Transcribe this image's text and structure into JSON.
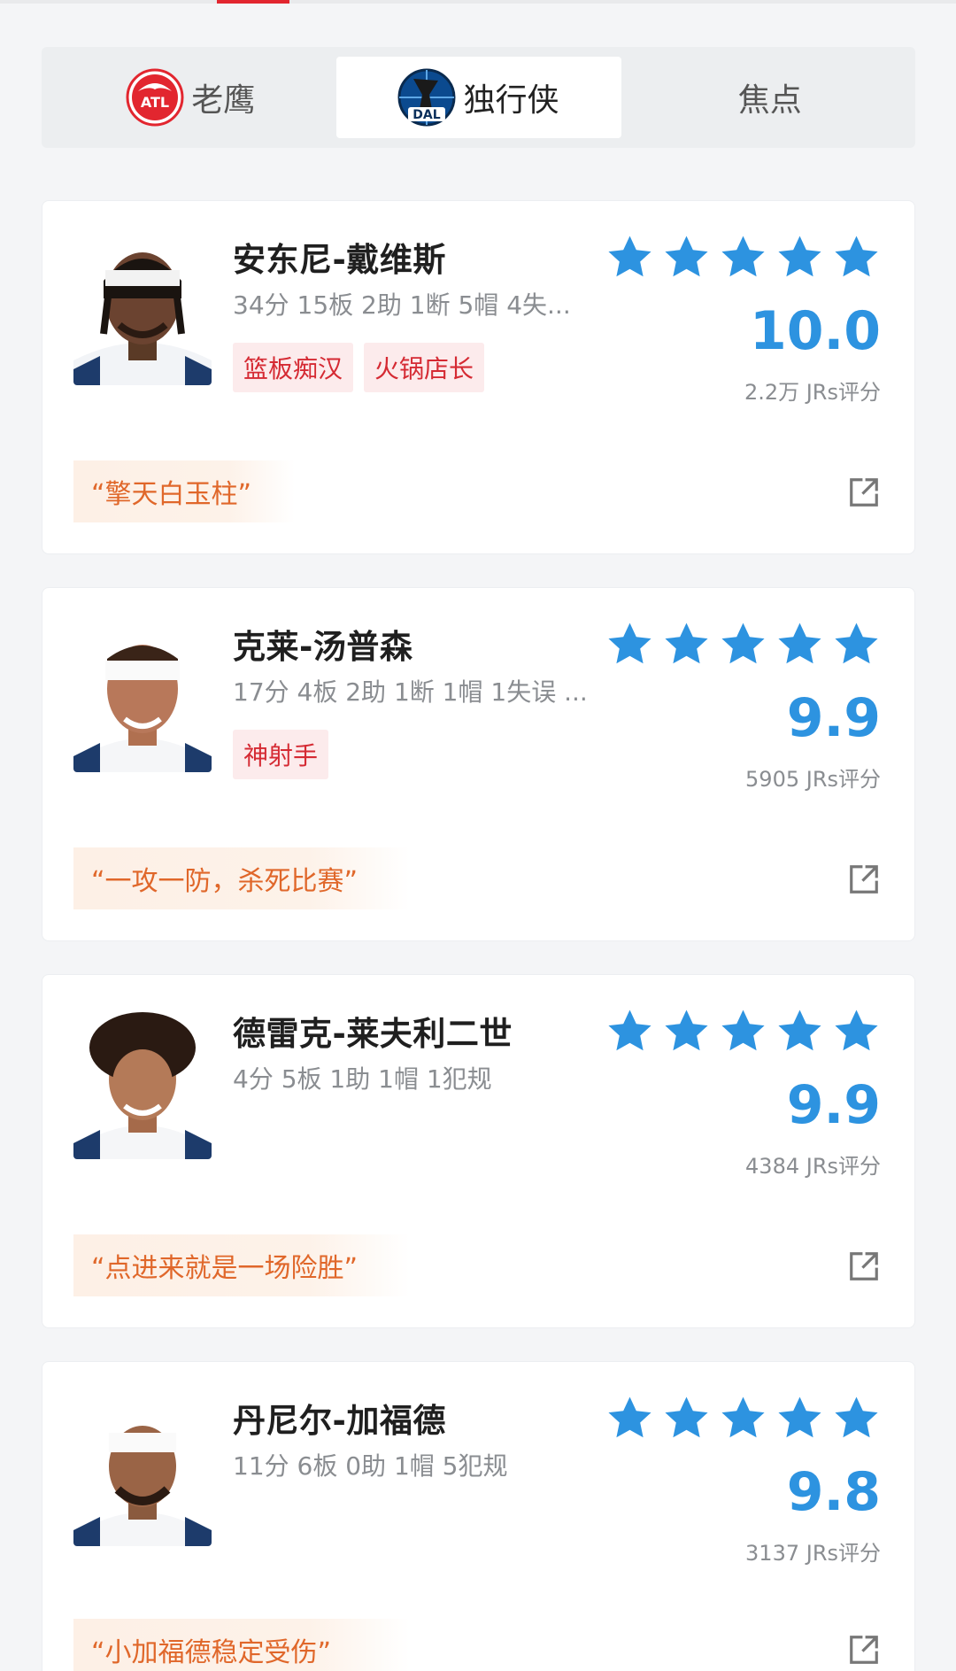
{
  "tabs": [
    {
      "label": "老鹰",
      "logo_text": "ATL",
      "active": false
    },
    {
      "label": "独行侠",
      "logo_text": "DAL",
      "active": true
    },
    {
      "label": "焦点",
      "active": false
    }
  ],
  "colors": {
    "accent_blue": "#2d93e0",
    "tag_red": "#d52a33",
    "quote_orange": "#e0672a",
    "atl_red": "#e2262f"
  },
  "players": [
    {
      "name": "安东尼-戴维斯",
      "stats": "34分 15板 2助 1断 5帽 4失...",
      "tags": [
        "篮板痴汉",
        "火锅店长"
      ],
      "stars": 5,
      "score": "10.0",
      "raters": "2.2万 JRs评分",
      "quote": "“擎天白玉柱”"
    },
    {
      "name": "克莱-汤普森",
      "stats": "17分 4板 2助 1断 1帽 1失误 ...",
      "tags": [
        "神射手"
      ],
      "stars": 5,
      "score": "9.9",
      "raters": "5905 JRs评分",
      "quote": "“一攻一防，杀死比赛”"
    },
    {
      "name": "德雷克-莱夫利二世",
      "stats": "4分 5板 1助 1帽 1犯规",
      "tags": [],
      "stars": 5,
      "score": "9.9",
      "raters": "4384 JRs评分",
      "quote": "“点进来就是一场险胜”"
    },
    {
      "name": "丹尼尔-加福德",
      "stats": "11分 6板 0助 1帽 5犯规",
      "tags": [],
      "stars": 5,
      "score": "9.8",
      "raters": "3137 JRs评分",
      "quote": "“小加福德稳定受伤”"
    }
  ]
}
